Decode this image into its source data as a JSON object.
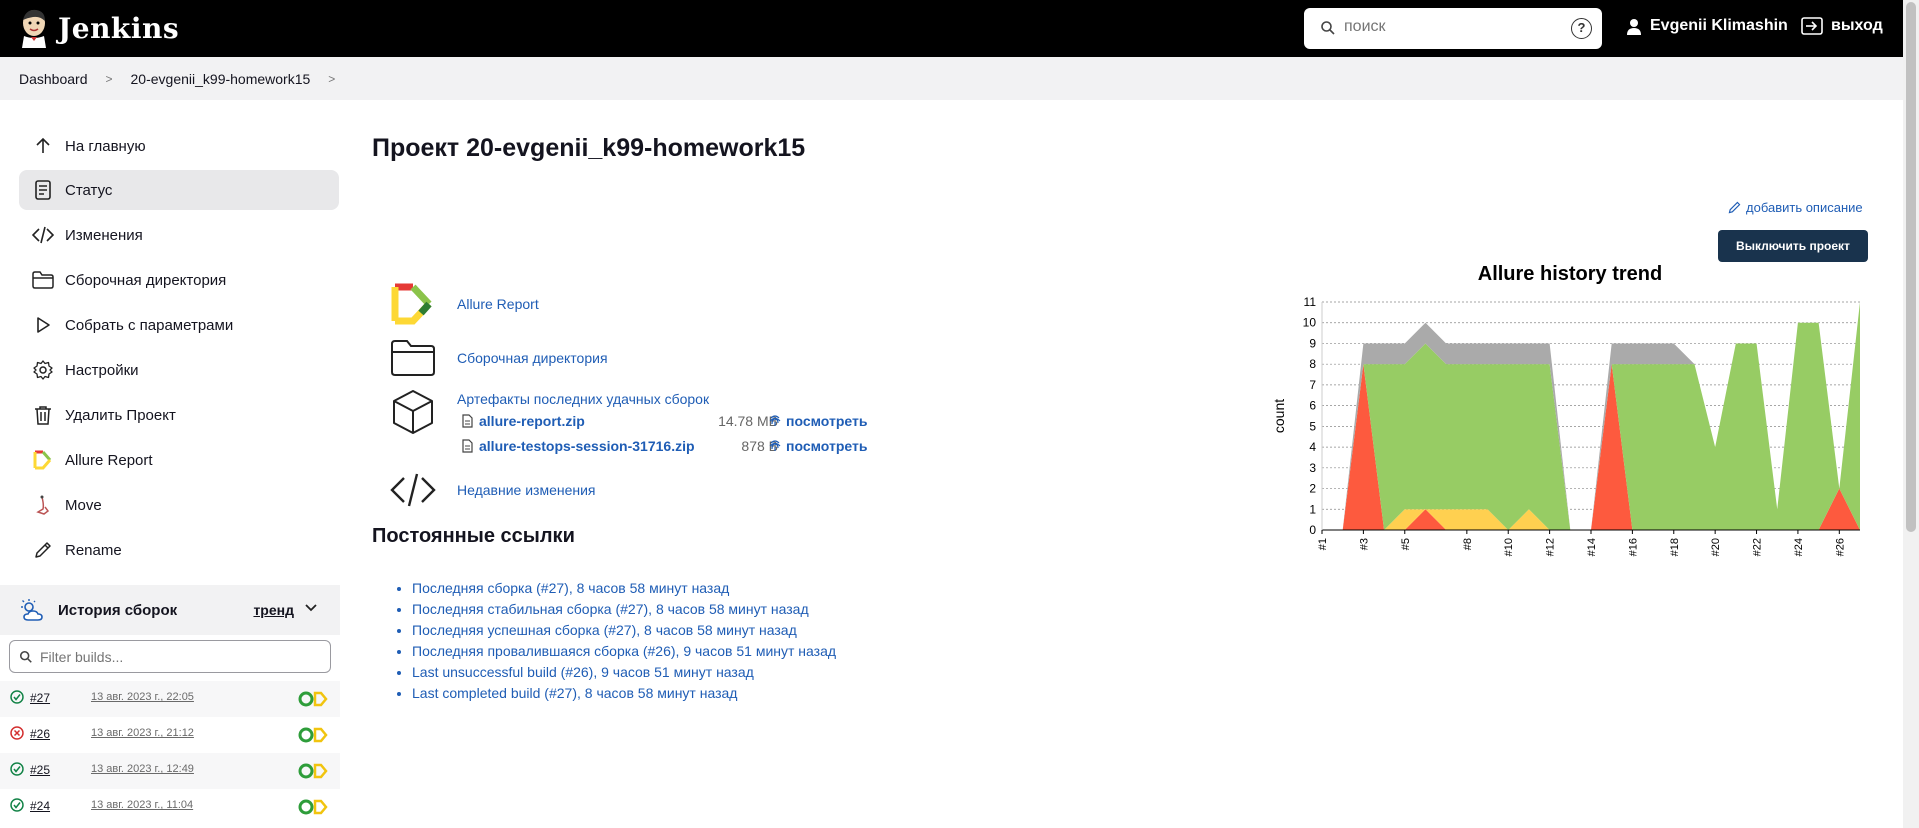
{
  "header": {
    "logo_text": "Jenkins",
    "search_placeholder": "поиск",
    "help_label": "?",
    "user_name": "Evgenii Klimashin",
    "logout_label": "выход"
  },
  "breadcrumb": {
    "items": [
      "Dashboard",
      "20-evgenii_k99-homework15"
    ]
  },
  "sidebar": {
    "items": [
      {
        "label": "На главную",
        "icon": "arrow-up-icon"
      },
      {
        "label": "Статус",
        "icon": "document-icon"
      },
      {
        "label": "Изменения",
        "icon": "code-icon"
      },
      {
        "label": "Сборочная директория",
        "icon": "folder-icon"
      },
      {
        "label": "Собрать с параметрами",
        "icon": "play-icon"
      },
      {
        "label": "Настройки",
        "icon": "gear-icon"
      },
      {
        "label": "Удалить Проект",
        "icon": "trash-icon"
      },
      {
        "label": "Allure Report",
        "icon": "allure-icon"
      },
      {
        "label": "Move",
        "icon": "move-icon"
      },
      {
        "label": "Rename",
        "icon": "pencil-icon"
      }
    ],
    "active_index": 1,
    "history_title": "История сборок",
    "history_trend": "тренд",
    "filter_placeholder": "Filter builds..."
  },
  "builds": [
    {
      "num": "#27",
      "date": "13 авг. 2023 г., 22:05",
      "status": "success"
    },
    {
      "num": "#26",
      "date": "13 авг. 2023 г., 21:12",
      "status": "failed"
    },
    {
      "num": "#25",
      "date": "13 авг. 2023 г., 12:49",
      "status": "success"
    },
    {
      "num": "#24",
      "date": "13 авг. 2023 г., 11:04",
      "status": "success"
    }
  ],
  "main": {
    "title": "Проект 20-evgenii_k99-homework15",
    "add_description": "добавить описание",
    "disable_button": "Выключить проект",
    "links": {
      "allure_report": "Allure Report",
      "workspace": "Сборочная директория",
      "artifacts_title": "Артефакты последних удачных сборок",
      "recent_changes": "Недавние изменения"
    },
    "artifacts": [
      {
        "name": "allure-report.zip",
        "size": "14.78 MB",
        "view": "посмотреть"
      },
      {
        "name": "allure-testops-session-31716.zip",
        "size": "878 B",
        "view": "посмотреть"
      }
    ],
    "permalinks_title": "Постоянные ссылки",
    "permalinks": [
      "Последняя сборка (#27), 8 часов 58 минут назад",
      "Последняя стабильная сборка (#27), 8 часов 58 минут назад",
      "Последняя успешная сборка (#27), 8 часов 58 минут назад",
      "Последняя провалившаяся сборка (#26), 9 часов 51 минут назад",
      "Last unsuccessful build (#26), 9 часов 51 минут назад",
      "Last completed build (#27), 8 часов 58 минут назад"
    ]
  },
  "colors": {
    "header_bg": "#000000",
    "link": "#1f5db5",
    "button_bg": "#19334d",
    "passed": "#97cc64",
    "failed": "#fd5a3e",
    "broken": "#ffd050",
    "skipped": "#aaaaaa"
  },
  "chart_data": {
    "type": "area",
    "title": "Allure history trend",
    "ylabel": "count",
    "xlabel": "",
    "ylim": [
      0,
      11
    ],
    "yticks": [
      0,
      1,
      2,
      3,
      4,
      5,
      6,
      7,
      8,
      9,
      10,
      11
    ],
    "x": [
      "#1",
      "#2",
      "#3",
      "#4",
      "#5",
      "#6",
      "#7",
      "#8",
      "#9",
      "#10",
      "#11",
      "#12",
      "#13",
      "#14",
      "#15",
      "#16",
      "#17",
      "#18",
      "#19",
      "#20",
      "#21",
      "#22",
      "#23",
      "#24",
      "#25",
      "#26",
      "#27"
    ],
    "x_tick_labels": [
      "#1",
      "#3",
      "#5",
      "#8",
      "#10",
      "#12",
      "#14",
      "#16",
      "#18",
      "#20",
      "#22",
      "#24",
      "#26"
    ],
    "series": [
      {
        "name": "failed",
        "values": [
          0,
          0,
          8,
          0,
          0,
          1,
          0,
          0,
          0,
          0,
          0,
          0,
          0,
          0,
          8,
          0,
          0,
          0,
          0,
          0,
          0,
          0,
          0,
          0,
          0,
          2,
          0
        ]
      },
      {
        "name": "broken",
        "values": [
          0,
          0,
          0,
          0,
          1,
          0,
          1,
          1,
          1,
          0,
          1,
          0,
          0,
          0,
          0,
          0,
          0,
          0,
          0,
          0,
          0,
          0,
          0,
          0,
          0,
          0,
          0
        ]
      },
      {
        "name": "passed",
        "values": [
          0,
          0,
          0,
          8,
          7,
          8,
          7,
          7,
          7,
          8,
          7,
          8,
          0,
          0,
          0,
          8,
          8,
          8,
          8,
          4,
          9,
          9,
          1,
          10,
          10,
          0,
          11
        ]
      },
      {
        "name": "skipped",
        "values": [
          0,
          0,
          1,
          1,
          1,
          1,
          1,
          1,
          1,
          1,
          1,
          1,
          0,
          0,
          1,
          1,
          1,
          1,
          0,
          0,
          0,
          0,
          0,
          0,
          0,
          0,
          0
        ]
      }
    ]
  }
}
